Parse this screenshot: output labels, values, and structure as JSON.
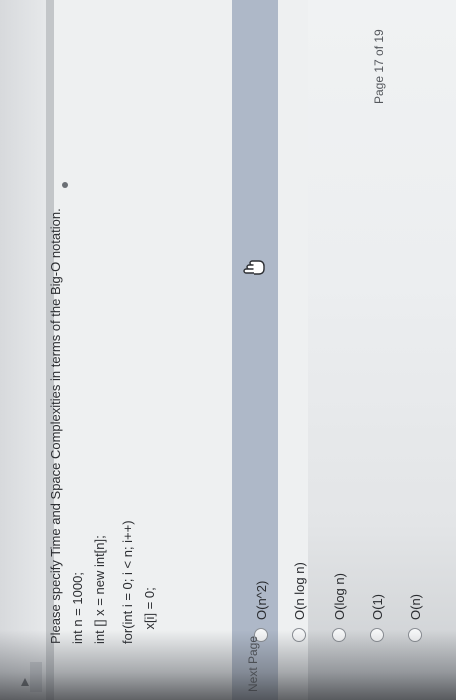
{
  "question": {
    "prompt": "Please specify Time and Space Complexities in terms of the Big-O notation.",
    "code_lines": [
      "int n = 1000;",
      "int [] x = new int[n];",
      "for(int i = 0; i < n; i++)",
      "    x[i] = 0;"
    ]
  },
  "options": [
    {
      "label": "O(n^2)"
    },
    {
      "label": "O(n log n)"
    },
    {
      "label": "O(log n)"
    },
    {
      "label": "O(1)"
    },
    {
      "label": "O(n)"
    }
  ],
  "navigation": {
    "next_label": "Next Page",
    "page_indicator": "Page 17 of 19"
  },
  "icons": {
    "pointer": "hand-pointer-icon",
    "collapse": "triangle-arrow-icon"
  }
}
